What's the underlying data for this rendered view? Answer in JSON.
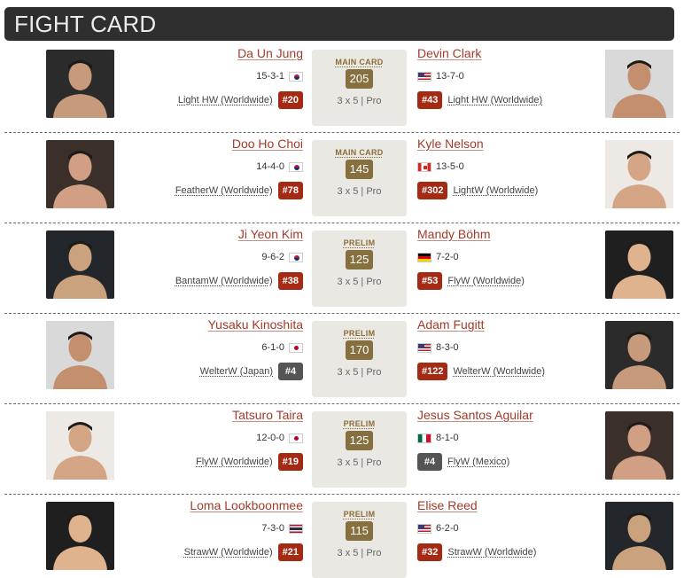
{
  "header": {
    "title": "FIGHT CARD"
  },
  "fights": [
    {
      "card": "MAIN CARD",
      "weight": "205",
      "rounds": "3 x 5  |  Pro",
      "left": {
        "name": "Da Un Jung",
        "record": "15-3-1",
        "flag": "kr",
        "division": "Light HW (Worldwide)",
        "rank": "#20",
        "rank_style": "red"
      },
      "right": {
        "name": "Devin Clark",
        "record": "13-7-0",
        "flag": "us",
        "division": "Light HW (Worldwide)",
        "rank": "#43",
        "rank_style": "red"
      }
    },
    {
      "card": "MAIN CARD",
      "weight": "145",
      "rounds": "3 x 5  |  Pro",
      "left": {
        "name": "Doo Ho Choi",
        "record": "14-4-0",
        "flag": "kr",
        "division": "FeatherW (Worldwide)",
        "rank": "#78",
        "rank_style": "red"
      },
      "right": {
        "name": "Kyle Nelson",
        "record": "13-5-0",
        "flag": "ca",
        "division": "LightW (Worldwide)",
        "rank": "#302",
        "rank_style": "red"
      }
    },
    {
      "card": "PRELIM",
      "weight": "125",
      "rounds": "3 x 5  |  Pro",
      "left": {
        "name": "Ji Yeon Kim",
        "record": "9-6-2",
        "flag": "kr",
        "division": "BantamW (Worldwide)",
        "rank": "#38",
        "rank_style": "red"
      },
      "right": {
        "name": "Mandy Böhm",
        "record": "7-2-0",
        "flag": "de",
        "division": "FlyW (Worldwide)",
        "rank": "#53",
        "rank_style": "red"
      }
    },
    {
      "card": "PRELIM",
      "weight": "170",
      "rounds": "3 x 5  |  Pro",
      "left": {
        "name": "Yusaku Kinoshita",
        "record": "6-1-0",
        "flag": "jp",
        "division": "WelterW (Japan)",
        "rank": "#4",
        "rank_style": "gray"
      },
      "right": {
        "name": "Adam Fugitt",
        "record": "8-3-0",
        "flag": "us",
        "division": "WelterW (Worldwide)",
        "rank": "#122",
        "rank_style": "red"
      }
    },
    {
      "card": "PRELIM",
      "weight": "125",
      "rounds": "3 x 5  |  Pro",
      "left": {
        "name": "Tatsuro Taira",
        "record": "12-0-0",
        "flag": "jp",
        "division": "FlyW (Worldwide)",
        "rank": "#19",
        "rank_style": "red"
      },
      "right": {
        "name": "Jesus Santos Aguilar",
        "record": "8-1-0",
        "flag": "mx",
        "division": "FlyW (Mexico)",
        "rank": "#4",
        "rank_style": "gray"
      }
    },
    {
      "card": "PRELIM",
      "weight": "115",
      "rounds": "3 x 5  |  Pro",
      "left": {
        "name": "Loma Lookboonmee",
        "record": "7-3-0",
        "flag": "th",
        "division": "StrawW (Worldwide)",
        "rank": "#21",
        "rank_style": "red"
      },
      "right": {
        "name": "Elise Reed",
        "record": "6-2-0",
        "flag": "us",
        "division": "StrawW (Worldwide)",
        "rank": "#32",
        "rank_style": "red"
      }
    }
  ]
}
